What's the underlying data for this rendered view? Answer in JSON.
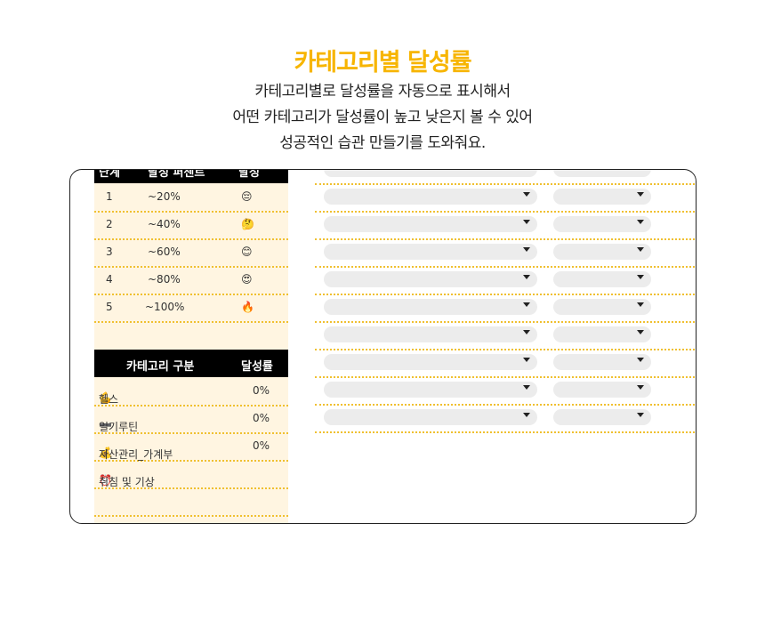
{
  "headline": "카테고리별 달성률",
  "description_lines": [
    "카테고리별로 달성률을 자동으로 표시해서",
    "어떤 카테고리가 달성률이 높고 낮은지 볼 수 있어",
    "성공적인 습관 만들기를 도와줘요."
  ],
  "level_table": {
    "headers": [
      "단계",
      "달성 퍼센트",
      "달성"
    ],
    "rows": [
      {
        "level": "1",
        "range": "~20%",
        "emoji": "😔"
      },
      {
        "level": "2",
        "range": "~40%",
        "emoji": "🤔"
      },
      {
        "level": "3",
        "range": "~60%",
        "emoji": "😊"
      },
      {
        "level": "4",
        "range": "~80%",
        "emoji": "😍"
      },
      {
        "level": "5",
        "range": "~100%",
        "emoji": "🔥"
      }
    ]
  },
  "category_table": {
    "headers": [
      "카테고리 구분",
      "달성률"
    ],
    "rows": [
      {
        "icon": "💪",
        "icon_name": "flexed-biceps-icon",
        "name": "헬스",
        "rate": "0%"
      },
      {
        "icon": "➖",
        "icon_name": "dash-icon",
        "name": "일기루틴",
        "rate": "0%"
      },
      {
        "icon": "💰",
        "icon_name": "money-bag-icon",
        "name": "자산관리_가계부",
        "rate": "0%"
      },
      {
        "icon": "⏰",
        "icon_name": "alarm-clock-icon",
        "name": "취침 및 기상",
        "rate": ""
      }
    ]
  },
  "colors": {
    "accent": "#f7b500",
    "table_bg": "#fff5e1",
    "header_bg": "#000000",
    "dotted_line": "#f0c030",
    "select_bg": "#ececec"
  }
}
